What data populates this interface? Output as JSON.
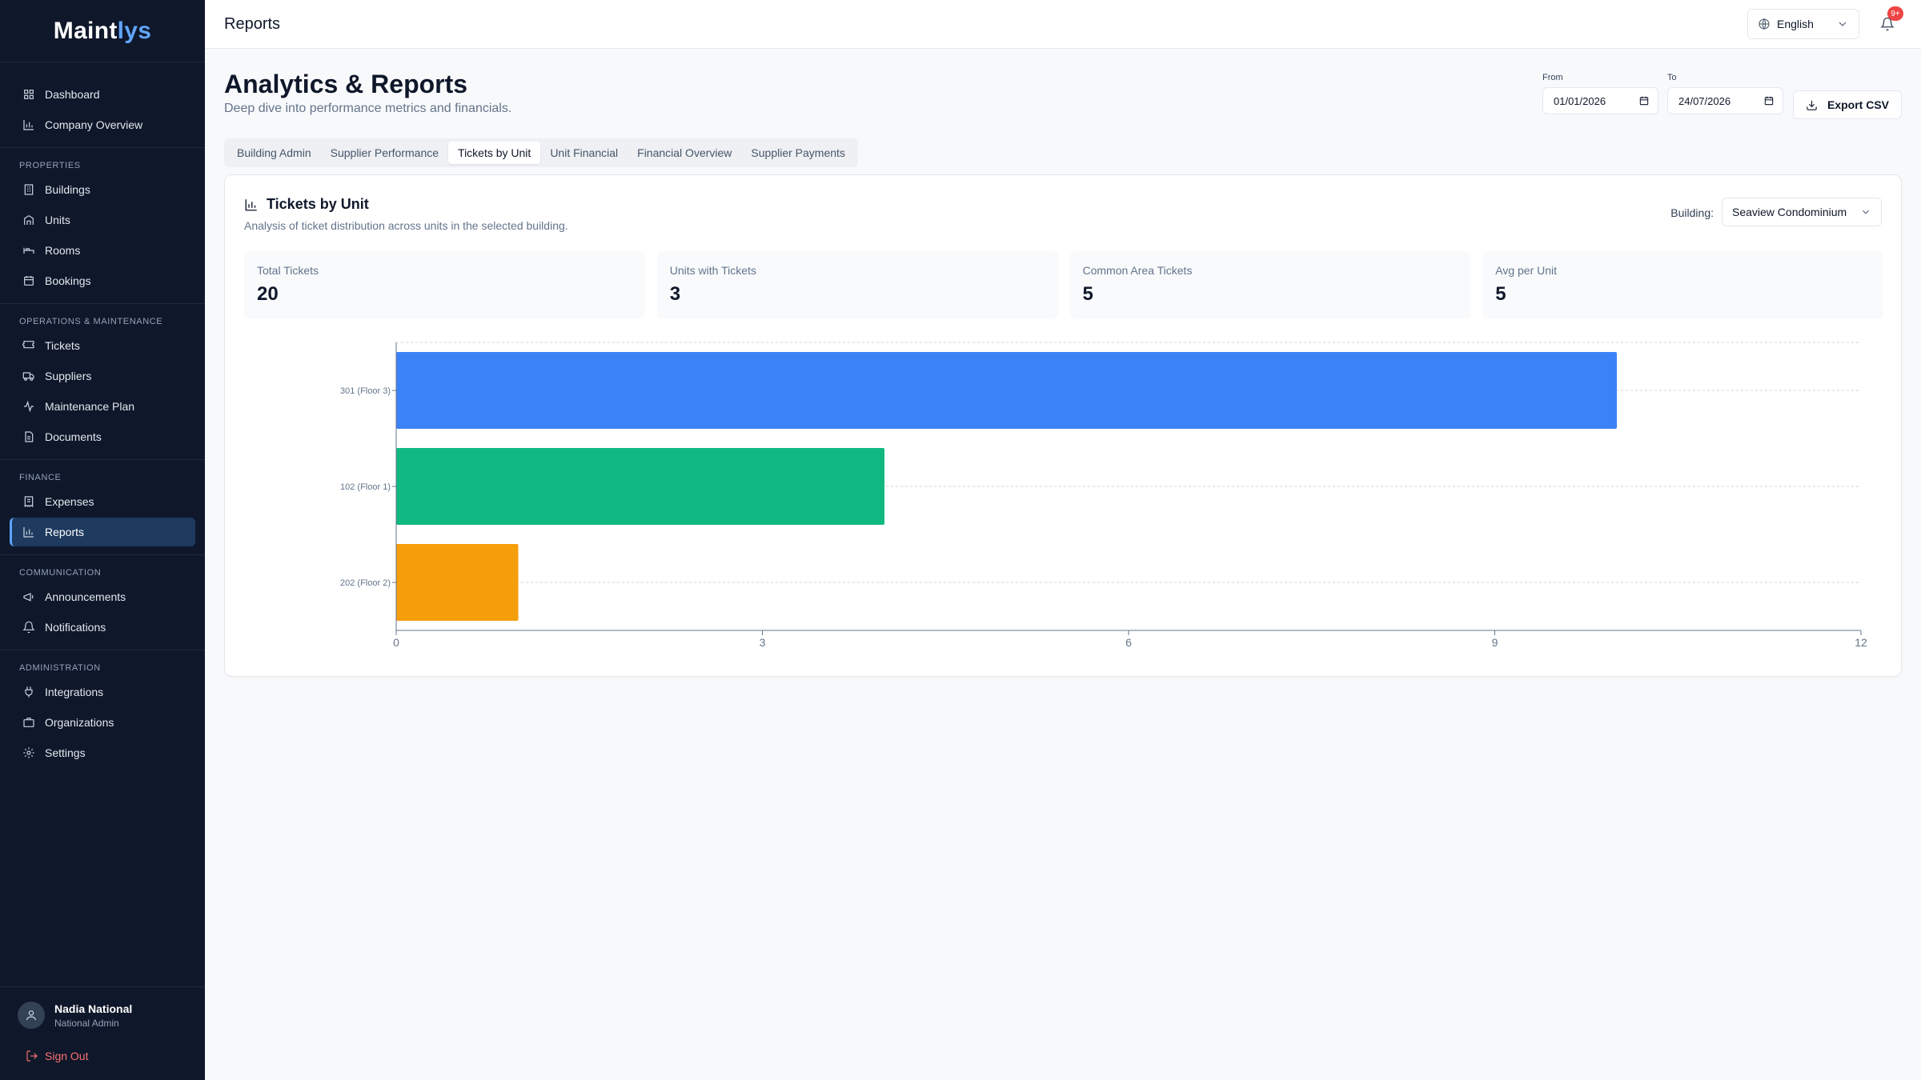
{
  "app": {
    "logo_main": "Maint",
    "logo_accent": "lys"
  },
  "sidebar": {
    "top_items": [
      {
        "label": "Dashboard",
        "icon": "grid-icon"
      },
      {
        "label": "Company Overview",
        "icon": "bar-chart-icon"
      }
    ],
    "sections": [
      {
        "title": "PROPERTIES",
        "items": [
          {
            "label": "Buildings",
            "icon": "building-icon"
          },
          {
            "label": "Units",
            "icon": "units-icon"
          },
          {
            "label": "Rooms",
            "icon": "bed-icon"
          },
          {
            "label": "Bookings",
            "icon": "calendar-icon"
          }
        ]
      },
      {
        "title": "OPERATIONS & MAINTENANCE",
        "items": [
          {
            "label": "Tickets",
            "icon": "ticket-icon"
          },
          {
            "label": "Suppliers",
            "icon": "truck-icon"
          },
          {
            "label": "Maintenance Plan",
            "icon": "activity-icon"
          },
          {
            "label": "Documents",
            "icon": "file-icon"
          }
        ]
      },
      {
        "title": "FINANCE",
        "items": [
          {
            "label": "Expenses",
            "icon": "receipt-icon"
          },
          {
            "label": "Reports",
            "icon": "bar-chart-icon",
            "active": true
          }
        ]
      },
      {
        "title": "COMMUNICATION",
        "items": [
          {
            "label": "Announcements",
            "icon": "megaphone-icon"
          },
          {
            "label": "Notifications",
            "icon": "bell-icon"
          }
        ]
      },
      {
        "title": "ADMINISTRATION",
        "items": [
          {
            "label": "Integrations",
            "icon": "plug-icon"
          },
          {
            "label": "Organizations",
            "icon": "briefcase-icon"
          },
          {
            "label": "Settings",
            "icon": "gear-icon"
          }
        ]
      }
    ],
    "user": {
      "name": "Nadia National",
      "role": "National Admin"
    },
    "sign_out": "Sign Out"
  },
  "topbar": {
    "title": "Reports",
    "language": "English",
    "notification_badge": "9+"
  },
  "page": {
    "title": "Analytics & Reports",
    "subtitle": "Deep dive into performance metrics and financials.",
    "from_label": "From",
    "from_value": "01/01/2026",
    "to_label": "To",
    "to_value": "24/07/2026",
    "export_label": "Export CSV",
    "tabs": [
      {
        "label": "Building Admin"
      },
      {
        "label": "Supplier Performance"
      },
      {
        "label": "Tickets by Unit",
        "active": true
      },
      {
        "label": "Unit Financial"
      },
      {
        "label": "Financial Overview"
      },
      {
        "label": "Supplier Payments"
      }
    ]
  },
  "card": {
    "title": "Tickets by Unit",
    "subtitle": "Analysis of ticket distribution across units in the selected building.",
    "building_label": "Building:",
    "building_value": "Seaview Condominium",
    "stats": [
      {
        "label": "Total Tickets",
        "value": "20"
      },
      {
        "label": "Units with Tickets",
        "value": "3"
      },
      {
        "label": "Common Area Tickets",
        "value": "5"
      },
      {
        "label": "Avg per Unit",
        "value": "5"
      }
    ]
  },
  "chart_data": {
    "type": "bar",
    "orientation": "horizontal",
    "categories": [
      "301 (Floor 3)",
      "102 (Floor 1)",
      "202 (Floor 2)"
    ],
    "values": [
      10,
      4,
      1
    ],
    "colors": [
      "#3b82f6",
      "#10b981",
      "#f59e0b"
    ],
    "xlim": [
      0,
      12
    ],
    "xticks": [
      0,
      3,
      6,
      9,
      12
    ],
    "grid": true
  }
}
